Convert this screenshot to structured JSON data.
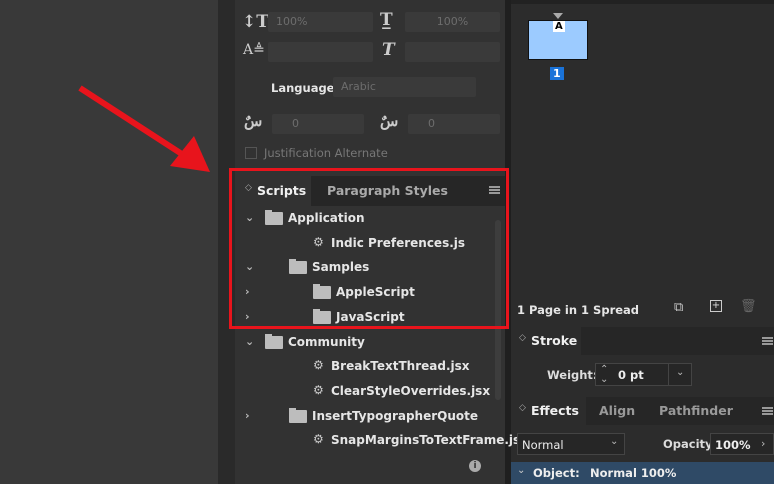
{
  "char_panel": {
    "vertical_scale": "100%",
    "horizontal_scale": "100%",
    "language_label": "Language:",
    "language_value": "Arabic",
    "kashida_left": "0",
    "kashida_right": "0",
    "justification_alternate": "Justification Alternate"
  },
  "scripts_panel": {
    "tabs": [
      "Scripts",
      "Paragraph Styles"
    ],
    "items": [
      {
        "label": "Application",
        "type": "folder",
        "level": 0,
        "state": "expanded"
      },
      {
        "label": "Indic Preferences.js",
        "type": "script",
        "level": 1,
        "state": "none"
      },
      {
        "label": "Samples",
        "type": "folder",
        "level": 1,
        "state": "expanded"
      },
      {
        "label": "AppleScript",
        "type": "folder",
        "level": 2,
        "state": "collapsed"
      },
      {
        "label": "JavaScript",
        "type": "folder",
        "level": 2,
        "state": "collapsed"
      },
      {
        "label": "Community",
        "type": "folder",
        "level": 0,
        "state": "expanded"
      },
      {
        "label": "BreakTextThread.jsx",
        "type": "script",
        "level": 1,
        "state": "none"
      },
      {
        "label": "ClearStyleOverrides.jsx",
        "type": "script",
        "level": 1,
        "state": "none"
      },
      {
        "label": "InsertTypographerQuote",
        "type": "folder",
        "level": 1,
        "state": "collapsed"
      },
      {
        "label": "SnapMarginsToTextFrame.jsx",
        "type": "script",
        "level": 1,
        "state": "none"
      }
    ]
  },
  "pages": {
    "master_letter": "A",
    "page_number": "1",
    "status": "1 Page in 1 Spread"
  },
  "stroke": {
    "title": "Stroke",
    "weight_label": "Weight:",
    "weight_value": "0 pt"
  },
  "effects": {
    "tabs": [
      "Effects",
      "Align",
      "Pathfinder"
    ],
    "blend_mode": "Normal",
    "opacity_label": "Opacity:",
    "opacity_value": "100%",
    "object_label": "Object:",
    "object_value": "Normal 100%"
  },
  "colors": {
    "highlight": "#e8141c",
    "page_fill": "#9ccbff",
    "page_badge": "#1a73d9"
  }
}
